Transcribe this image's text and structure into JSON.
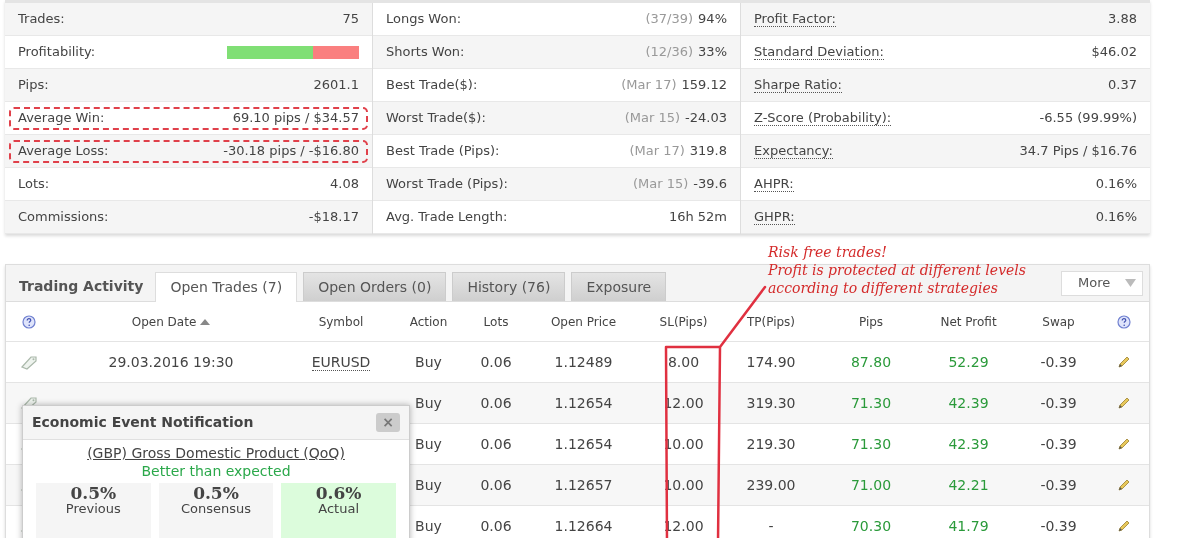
{
  "stats": {
    "left": [
      {
        "label": "Trades:",
        "value": "75",
        "highlighted": false
      },
      {
        "label": "Profitability:",
        "level": 0.65,
        "highlighted": false
      },
      {
        "label": "Pips:",
        "value": "2601.1",
        "highlighted": false
      },
      {
        "label": "Average Win:",
        "value": "69.10 pips / $34.57",
        "highlighted": true
      },
      {
        "label": "Average Loss:",
        "value": "-30.18 pips / -$16.80",
        "highlighted": true
      },
      {
        "label": "Lots:",
        "value": "4.08",
        "highlighted": false
      },
      {
        "label": "Commissions:",
        "value": "-$18.17",
        "highlighted": false
      }
    ],
    "middle": [
      {
        "label": "Longs Won:",
        "note": "(37/39)",
        "value": "94%"
      },
      {
        "label": "Shorts Won:",
        "note": "(12/36)",
        "value": "33%"
      },
      {
        "label": "Best Trade($):",
        "note": "(Mar 17)",
        "value": "159.12"
      },
      {
        "label": "Worst Trade($):",
        "note": "(Mar 15)",
        "value": "-24.03"
      },
      {
        "label": "Best Trade (Pips):",
        "note": "(Mar 17)",
        "value": "319.8"
      },
      {
        "label": "Worst Trade (Pips):",
        "note": "(Mar 15)",
        "value": "-39.6"
      },
      {
        "label": "Avg. Trade Length:",
        "value": "16h 52m"
      }
    ],
    "right": [
      {
        "label": "Profit Factor:",
        "value": "3.88"
      },
      {
        "label": "Standard Deviation:",
        "value": "$46.02"
      },
      {
        "label": "Sharpe Ratio:",
        "value": "0.37"
      },
      {
        "label": "Z-Score (Probability):",
        "value": "-6.55 (99.99%)"
      },
      {
        "label": "Expectancy:",
        "value": "34.7 Pips / $16.76"
      },
      {
        "label": "AHPR:",
        "value": "0.16%"
      },
      {
        "label": "GHPR:",
        "value": "0.16%"
      }
    ]
  },
  "annotation": {
    "lines": [
      "Risk free trades!",
      "Profit is protected at different levels",
      "according to different strategies"
    ]
  },
  "trading_activity": {
    "title": "Trading Activity",
    "tabs": [
      {
        "label": "Open Trades (7)",
        "selected": true
      },
      {
        "label": "Open Orders (0)",
        "selected": false
      },
      {
        "label": "History (76)",
        "selected": false
      },
      {
        "label": "Exposure",
        "selected": false
      }
    ],
    "more_button": "More",
    "columns": [
      "Open Date",
      "Symbol",
      "Action",
      "Lots",
      "Open Price",
      "SL(Pips)",
      "TP(Pips)",
      "Pips",
      "Net Profit",
      "Swap"
    ],
    "rows": [
      {
        "open_date": "29.03.2016 19:30",
        "symbol": "EURUSD",
        "action": "Buy",
        "lots": "0.06",
        "open_price": "1.12489",
        "sl": "8.00",
        "tp": "174.90",
        "pips": "87.80",
        "net_profit": "52.29",
        "swap": "-0.39"
      },
      {
        "action": "Buy",
        "lots": "0.06",
        "open_price": "1.12654",
        "sl": "12.00",
        "tp": "319.30",
        "pips": "71.30",
        "net_profit": "42.39",
        "swap": "-0.39"
      },
      {
        "action": "Buy",
        "lots": "0.06",
        "open_price": "1.12654",
        "sl": "10.00",
        "tp": "219.30",
        "pips": "71.30",
        "net_profit": "42.39",
        "swap": "-0.39"
      },
      {
        "action": "Buy",
        "lots": "0.06",
        "open_price": "1.12657",
        "sl": "10.00",
        "tp": "239.00",
        "pips": "71.00",
        "net_profit": "42.21",
        "swap": "-0.39"
      },
      {
        "action": "Buy",
        "lots": "0.06",
        "open_price": "1.12664",
        "sl": "12.00",
        "tp": "-",
        "pips": "70.30",
        "net_profit": "41.79",
        "swap": "-0.39"
      }
    ]
  },
  "notification": {
    "title": "Economic Event Notification",
    "close": "×",
    "event": "(GBP) Gross Domestic Product (QoQ)",
    "outcome": "Better than expected",
    "figures": [
      {
        "value": "0.5%",
        "label": "Previous",
        "highlighted": false
      },
      {
        "value": "0.5%",
        "label": "Consensus",
        "highlighted": false
      },
      {
        "value": "0.6%",
        "label": "Actual",
        "highlighted": true
      }
    ]
  }
}
